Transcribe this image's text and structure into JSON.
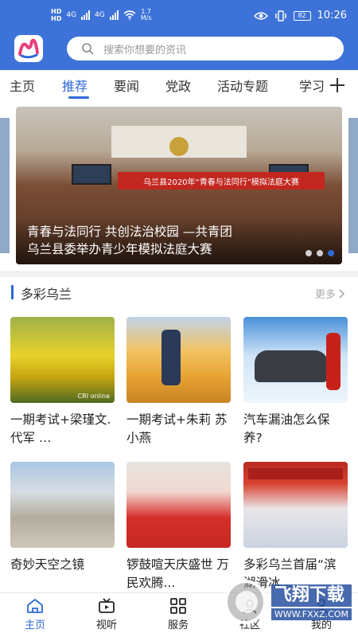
{
  "colors": {
    "brand_blue": "#3d73d8",
    "active_tab": "#2f6ad6",
    "banner_red": "#c2271f"
  },
  "status_bar": {
    "hd_top": "HD",
    "hd_bottom": "HD",
    "net_1": "4G",
    "net_2": "4G",
    "speed_value": "1.7",
    "speed_unit": "M/s",
    "battery": "82",
    "time": "10:26",
    "icons": [
      "signal-icon",
      "wifi-icon",
      "eye-icon",
      "vibrate-icon",
      "battery-icon"
    ]
  },
  "header": {
    "logo_icon": "app-logo",
    "search": {
      "icon": "search-icon",
      "placeholder": "搜索你想要的资讯"
    }
  },
  "tabs": {
    "items": [
      "主页",
      "推荐",
      "要闻",
      "党政",
      "活动专题",
      "学习"
    ],
    "active": "推荐",
    "add_icon": "plus-icon"
  },
  "banner": {
    "sign_text": "乌兰县2020年“青春与法同行”模拟法庭大赛",
    "caption_line1": "青春与法同行 共创法治校园 —共青团",
    "caption_line2": "乌兰县委举办青少年模拟法庭大赛",
    "dots_total": 3,
    "dots_active_index": 2
  },
  "section": {
    "title": "多彩乌兰",
    "more": "更多",
    "more_icon": "chevron-right-icon"
  },
  "cards": [
    {
      "title": "一期考试+梁瑾文.代军 …",
      "watermark": "CRI online"
    },
    {
      "title": "一期考试+朱莉 苏小燕"
    },
    {
      "title": "汽车漏油怎么保养?"
    },
    {
      "title": "奇妙天空之镜"
    },
    {
      "title": "锣鼓喧天庆盛世 万民欢腾..."
    },
    {
      "title": "多彩乌兰首届“滨湖滑冰..."
    }
  ],
  "bottom_nav": {
    "items": [
      {
        "label": "主页",
        "icon": "home-icon",
        "active": true
      },
      {
        "label": "视听",
        "icon": "video-icon",
        "active": false
      },
      {
        "label": "服务",
        "icon": "grid-icon",
        "active": false
      },
      {
        "label": "社区",
        "icon": "community-icon",
        "active": false
      },
      {
        "label": "我的",
        "icon": "profile-icon",
        "active": false
      }
    ]
  },
  "watermark": {
    "name": "飞翔下载",
    "url": "WWW.FXXZ.COM"
  }
}
